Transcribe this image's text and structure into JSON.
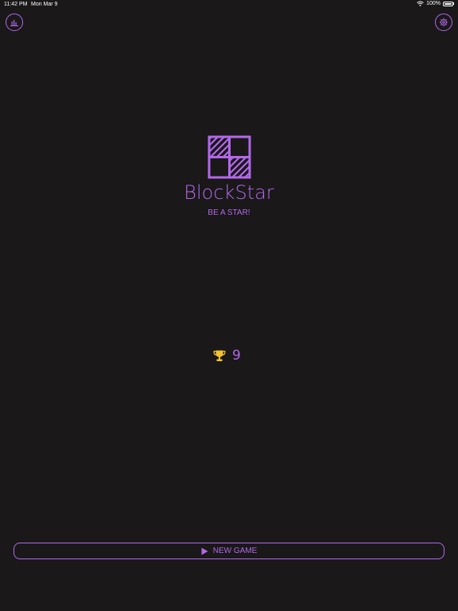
{
  "status_bar": {
    "time": "11:42 PM",
    "date": "Mon Mar 9",
    "battery": "100%",
    "battery_level": 1.0,
    "icons": [
      "wifi-icon",
      "battery-icon"
    ]
  },
  "toolbar": {
    "stats_icon": "bar-chart-icon",
    "settings_icon": "gear-icon"
  },
  "app": {
    "title": "BlockStar",
    "tagline": "BE A STAR!",
    "logo_icon": "blockstar-logo"
  },
  "best_score": {
    "icon": "trophy-icon",
    "value": "9"
  },
  "new_game": {
    "label": "NEW GAME",
    "icon": "play-icon"
  },
  "colors": {
    "background": "#1a1819",
    "accent": "#b368ec",
    "trophy": "#f2c232",
    "status_text": "#ffffff"
  }
}
